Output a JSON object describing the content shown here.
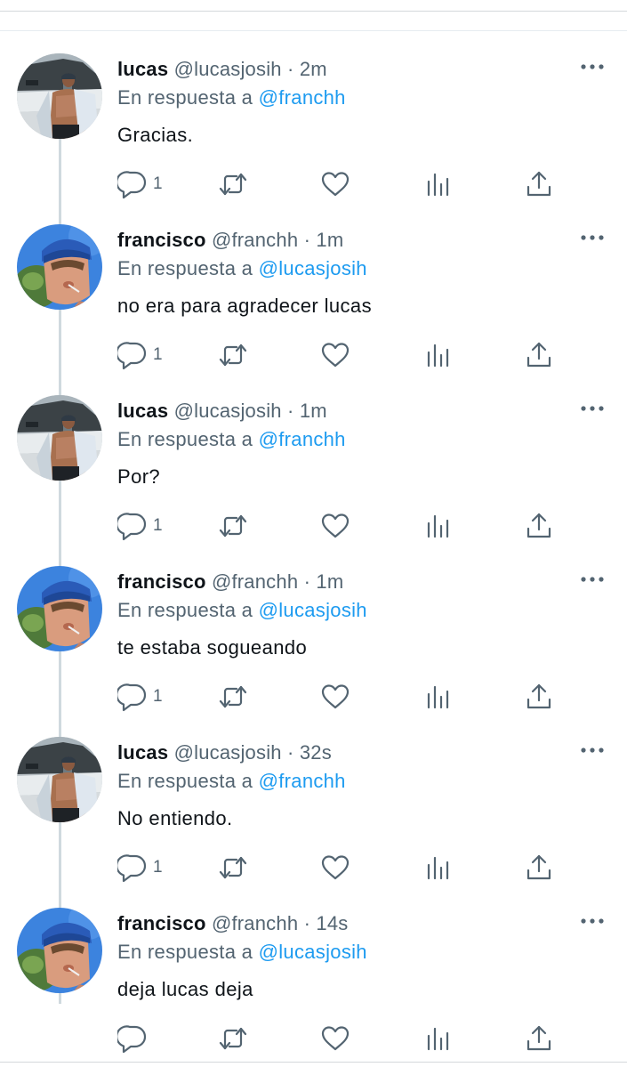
{
  "colors": {
    "text": "#0f1419",
    "secondary": "#536471",
    "link": "#1d9bf0",
    "thread_line": "#cfd9de"
  },
  "icons": {
    "more": "more-dots-icon",
    "reply": "reply-icon",
    "retweet": "retweet-icon",
    "like": "heart-icon",
    "analytics": "analytics-icon",
    "share": "share-icon"
  },
  "thread": {
    "tweets": [
      {
        "name": "lucas",
        "handle": "@lucasjosih",
        "separator": "·",
        "time": "2m",
        "reply_prefix": "En respuesta a",
        "reply_to": "@franchh",
        "text": "Gracias.",
        "reply_count": "1",
        "avatar": "lucas-avatar"
      },
      {
        "name": "francisco",
        "handle": "@franchh",
        "separator": "·",
        "time": "1m",
        "reply_prefix": "En respuesta a",
        "reply_to": "@lucasjosih",
        "text": "no era para agradecer lucas",
        "reply_count": "1",
        "avatar": "francisco-avatar"
      },
      {
        "name": "lucas",
        "handle": "@lucasjosih",
        "separator": "·",
        "time": "1m",
        "reply_prefix": "En respuesta a",
        "reply_to": "@franchh",
        "text": "Por?",
        "reply_count": "1",
        "avatar": "lucas-avatar"
      },
      {
        "name": "francisco",
        "handle": "@franchh",
        "separator": "·",
        "time": "1m",
        "reply_prefix": "En respuesta a",
        "reply_to": "@lucasjosih",
        "text": "te estaba sogueando",
        "reply_count": "1",
        "avatar": "francisco-avatar"
      },
      {
        "name": "lucas",
        "handle": "@lucasjosih",
        "separator": "·",
        "time": "32s",
        "reply_prefix": "En respuesta a",
        "reply_to": "@franchh",
        "text": "No entiendo.",
        "reply_count": "1",
        "avatar": "lucas-avatar"
      },
      {
        "name": "francisco",
        "handle": "@franchh",
        "separator": "·",
        "time": "14s",
        "reply_prefix": "En respuesta a",
        "reply_to": "@lucasjosih",
        "text": "deja lucas deja",
        "reply_count": "",
        "avatar": "francisco-avatar"
      }
    ]
  }
}
